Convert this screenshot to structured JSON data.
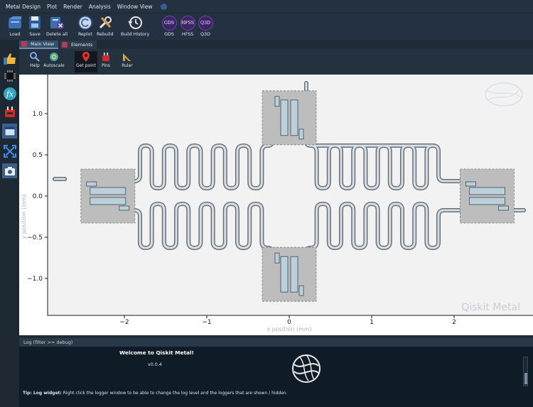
{
  "menu": [
    "Metal Design",
    "Plot",
    "Render",
    "Analysis",
    "Window View"
  ],
  "toolbar": {
    "load": "Load",
    "save": "Save",
    "delete_all": "Delete all",
    "replot": "Replot",
    "rebuild": "Rebuild",
    "build_history": "Build History",
    "gds_icon": "GDS",
    "gds": "GDS",
    "hfss_icon": "HFSS",
    "hfss": "HFSS",
    "q3d_icon": "Q3D",
    "q3d": "Q3D"
  },
  "tabs": {
    "main_view": "Main View",
    "elements": "Elements"
  },
  "subtoolbar": {
    "help": "Help",
    "autoscale": "Autoscale",
    "get_point": "Get point",
    "pins": "Pins",
    "ruler": "Ruler"
  },
  "plot": {
    "xlabel": "x position (mm)",
    "ylabel": "y position (mm)",
    "watermark": "Qiskit Metal",
    "xticks": [
      "−2",
      "−1",
      "0",
      "1",
      "2"
    ],
    "yticks": [
      "1.0",
      "0.5",
      "0.0",
      "−0.5",
      "−1.0"
    ]
  },
  "chart_data": {
    "type": "scatter",
    "xlabel": "x position (mm)",
    "ylabel": "y position (mm)",
    "xlim": [
      -2.95,
      2.95
    ],
    "ylim": [
      -1.45,
      1.45
    ],
    "grid": false,
    "transmons": [
      {
        "x": -2.2,
        "y": 0.0,
        "orientation": "horizontal"
      },
      {
        "x": 2.4,
        "y": 0.0,
        "orientation": "horizontal"
      },
      {
        "x": 0.0,
        "y": 0.95,
        "orientation": "vertical"
      },
      {
        "x": 0.0,
        "y": -0.95,
        "orientation": "vertical"
      }
    ]
  },
  "log": {
    "header": "Log  (filter >= debug)",
    "title": "Welcome to Qiskit Metal!",
    "version": "v0.0.4",
    "tip_bold": "Tip: Log widget:",
    "tip_text": " Right click the logger window to be able to change the log level and the loggers that are shown / hidden."
  },
  "colors": {
    "background": "#1f2c37",
    "plot_bg": "#ffffff",
    "qubit_pad": "#bcd0dc",
    "pocket": "#bdbdbd",
    "cpw": "#646f78"
  }
}
